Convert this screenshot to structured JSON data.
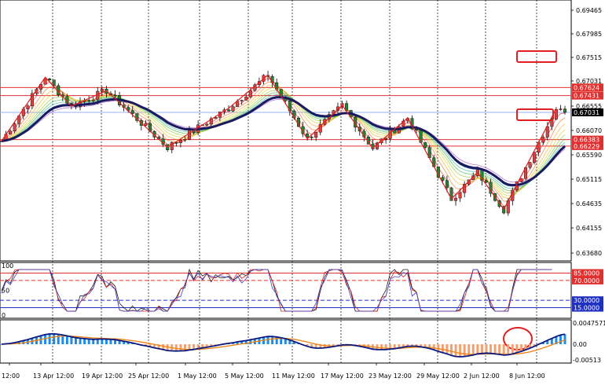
{
  "chart_data": {
    "type": "candlestick",
    "x_labels": [
      "12:00",
      "13 Apr 12:00",
      "19 Apr 12:00",
      "25 Apr 12:00",
      "1 May 12:00",
      "5 May 12:00",
      "11 May 12:00",
      "17 May 12:00",
      "23 May 12:00",
      "29 May 12:00",
      "2 Jun 12:00",
      "8 Jun 12:00"
    ],
    "price_panel": {
      "y_ticks": [
        "0.69465",
        "0.67985",
        "0.67515",
        "0.67031",
        "0.66555",
        "0.66070",
        "0.65590",
        "0.65115",
        "0.64635",
        "0.64155",
        "0.63680"
      ],
      "y_range": [
        0.6368,
        0.6947
      ],
      "current_price": "0.67031",
      "horizontal_lines": [
        {
          "label": "0.67624",
          "value": 0.67624,
          "color": "#e03030"
        },
        {
          "label": "0.67431",
          "value": 0.67431,
          "color": "#e03030"
        },
        {
          "label": "0.66383",
          "value": 0.66383,
          "color": "#e03030"
        },
        {
          "label": "0.66229",
          "value": 0.66229,
          "color": "#e03030"
        }
      ],
      "zigzag": [
        [
          0,
          0.6635
        ],
        [
          10,
          0.6787
        ],
        [
          16,
          0.6718
        ],
        [
          24,
          0.6755
        ],
        [
          38,
          0.662
        ],
        [
          52,
          0.6713
        ],
        [
          61,
          0.6792
        ],
        [
          70,
          0.664
        ],
        [
          78,
          0.672
        ],
        [
          85,
          0.6618
        ],
        [
          93,
          0.669
        ],
        [
          103,
          0.6497
        ],
        [
          109,
          0.656
        ],
        [
          115,
          0.6472
        ],
        [
          127,
          0.6712
        ]
      ],
      "annotation_boxes": [
        "upper-right-resistance",
        "right-support"
      ]
    },
    "rsi_panel": {
      "levels": [
        {
          "label": "85.0000",
          "value": 85,
          "color": "#e03030",
          "style": "solid"
        },
        {
          "label": "70.0000",
          "value": 70,
          "color": "#e03030",
          "style": "dashed"
        },
        {
          "label": "30.0000",
          "value": 30,
          "color": "#2030c0",
          "style": "dashed"
        },
        {
          "label": "15.0000",
          "value": 15,
          "color": "#2030c0",
          "style": "solid"
        }
      ],
      "y_ticks": [
        "100",
        "50",
        "0"
      ],
      "y_range": [
        0,
        100
      ]
    },
    "macd_panel": {
      "y_ticks": [
        "0.0047571",
        "0.00",
        "-0.00513"
      ],
      "y_range": [
        -0.00513,
        0.0047571
      ],
      "positive_color": "#1e8ce6",
      "negative_color": "#f4a070",
      "signal_color": "#f08010",
      "macd_color": "#0a1a80"
    },
    "colors": {
      "up_candle": "#e04040",
      "down_candle": "#2a8030",
      "slow_ma": "#1a1a60",
      "zigzag": "#e02020",
      "current_price_line": "#9ab0f0",
      "grid": "#000000"
    },
    "moving_average_ribbon": true,
    "gridlines": "vertical-dotted"
  }
}
